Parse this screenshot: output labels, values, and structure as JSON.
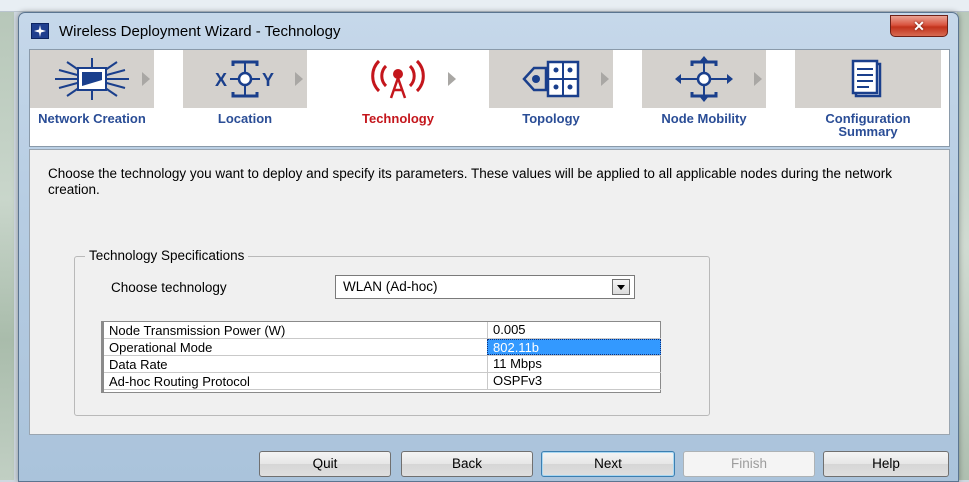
{
  "window": {
    "title": "Wireless Deployment Wizard - Technology",
    "close_symbol": "✕"
  },
  "steps": [
    {
      "label": "Network Creation",
      "icon": "network-creation-icon",
      "active": false
    },
    {
      "label": "Location",
      "icon": "location-icon",
      "active": false
    },
    {
      "label": "Technology",
      "icon": "wireless-tower-icon",
      "active": true
    },
    {
      "label": "Topology",
      "icon": "topology-icon",
      "active": false
    },
    {
      "label": "Node Mobility",
      "icon": "node-mobility-icon",
      "active": false
    },
    {
      "label": "Configuration Summary",
      "icon": "configuration-summary-icon",
      "active": false
    }
  ],
  "intro": "Choose the technology you want to deploy and specify its parameters. These values will be applied to all applicable nodes during the network creation.",
  "group": {
    "title": "Technology Specifications",
    "choose_label": "Choose technology",
    "selected_technology": "WLAN (Ad-hoc)"
  },
  "params": [
    {
      "key": "Node Transmission Power (W)",
      "value": "0.005",
      "selected": false
    },
    {
      "key": "Operational Mode",
      "value": "802.11b",
      "selected": true
    },
    {
      "key": "Data Rate",
      "value": "11 Mbps",
      "selected": false
    },
    {
      "key": "Ad-hoc Routing Protocol",
      "value": "OSPFv3",
      "selected": false
    }
  ],
  "buttons": {
    "quit": "Quit",
    "back": "Back",
    "next": "Next",
    "finish": "Finish",
    "help": "Help"
  },
  "colors": {
    "step_label": "#2a4d96",
    "step_label_active": "#c4161c",
    "selection": "#3399ff"
  }
}
